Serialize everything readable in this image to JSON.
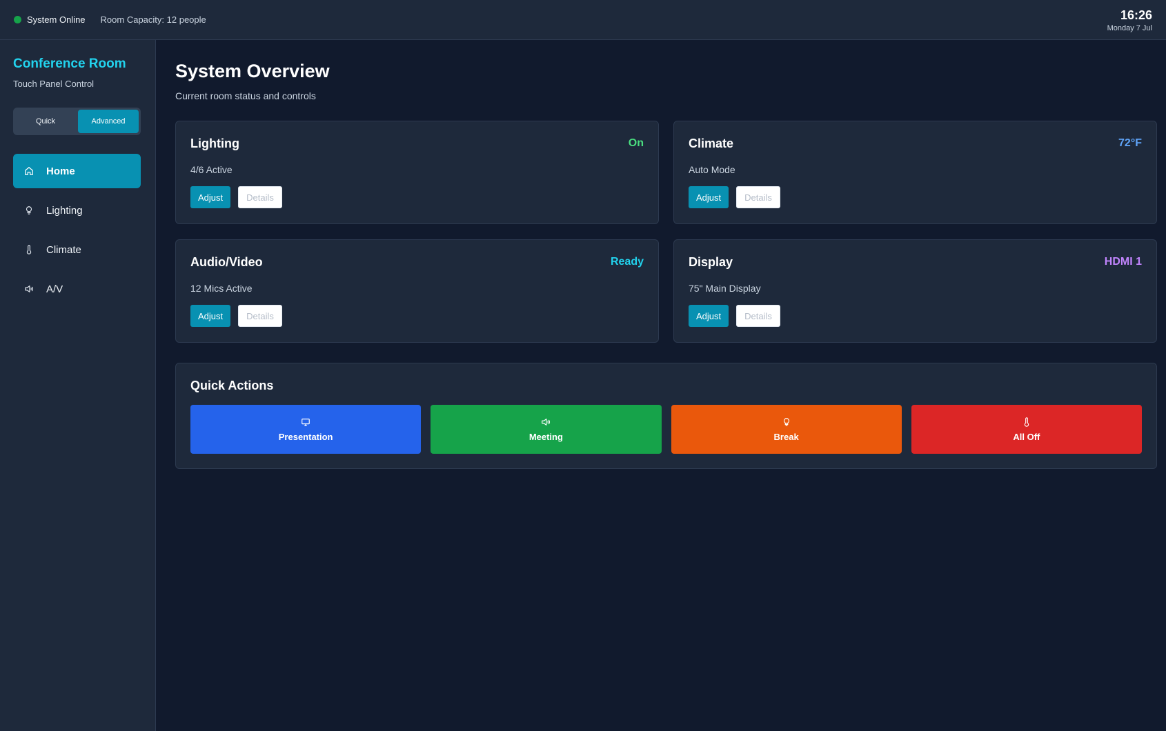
{
  "topbar": {
    "status_text": "System Online",
    "capacity_text": "Room Capacity: 12 people",
    "time": "16:26",
    "date": "Monday 7 Jul"
  },
  "sidebar": {
    "title": "Conference Room",
    "subtitle": "Touch Panel Control",
    "mode_toggle": {
      "quick": "Quick",
      "advanced": "Advanced",
      "selected": "Advanced"
    },
    "nav": [
      {
        "label": "Home",
        "icon": "home-icon",
        "active": true
      },
      {
        "label": "Lighting",
        "icon": "lightbulb-icon",
        "active": false
      },
      {
        "label": "Climate",
        "icon": "thermometer-icon",
        "active": false
      },
      {
        "label": "A/V",
        "icon": "speaker-icon",
        "active": false
      }
    ]
  },
  "main": {
    "title": "System Overview",
    "subtitle": "Current room status and controls",
    "cards": [
      {
        "title": "Lighting",
        "status": "On",
        "status_color": "#4ade80",
        "detail": "4/6 Active",
        "adjust": "Adjust",
        "details": "Details"
      },
      {
        "title": "Climate",
        "status": "72°F",
        "status_color": "#60a5fa",
        "detail": "Auto Mode",
        "adjust": "Adjust",
        "details": "Details"
      },
      {
        "title": "Audio/Video",
        "status": "Ready",
        "status_color": "#22d3ee",
        "detail": "12 Mics Active",
        "adjust": "Adjust",
        "details": "Details"
      },
      {
        "title": "Display",
        "status": "HDMI 1",
        "status_color": "#c084fc",
        "detail": "75\" Main Display",
        "adjust": "Adjust",
        "details": "Details"
      }
    ],
    "quick_actions": {
      "title": "Quick Actions",
      "actions": [
        {
          "label": "Presentation",
          "icon": "monitor-icon",
          "color": "#2563eb"
        },
        {
          "label": "Meeting",
          "icon": "speaker-icon",
          "color": "#16a34a"
        },
        {
          "label": "Break",
          "icon": "lightbulb-icon",
          "color": "#ea580c"
        },
        {
          "label": "All Off",
          "icon": "thermometer-icon",
          "color": "#dc2626"
        }
      ]
    }
  }
}
